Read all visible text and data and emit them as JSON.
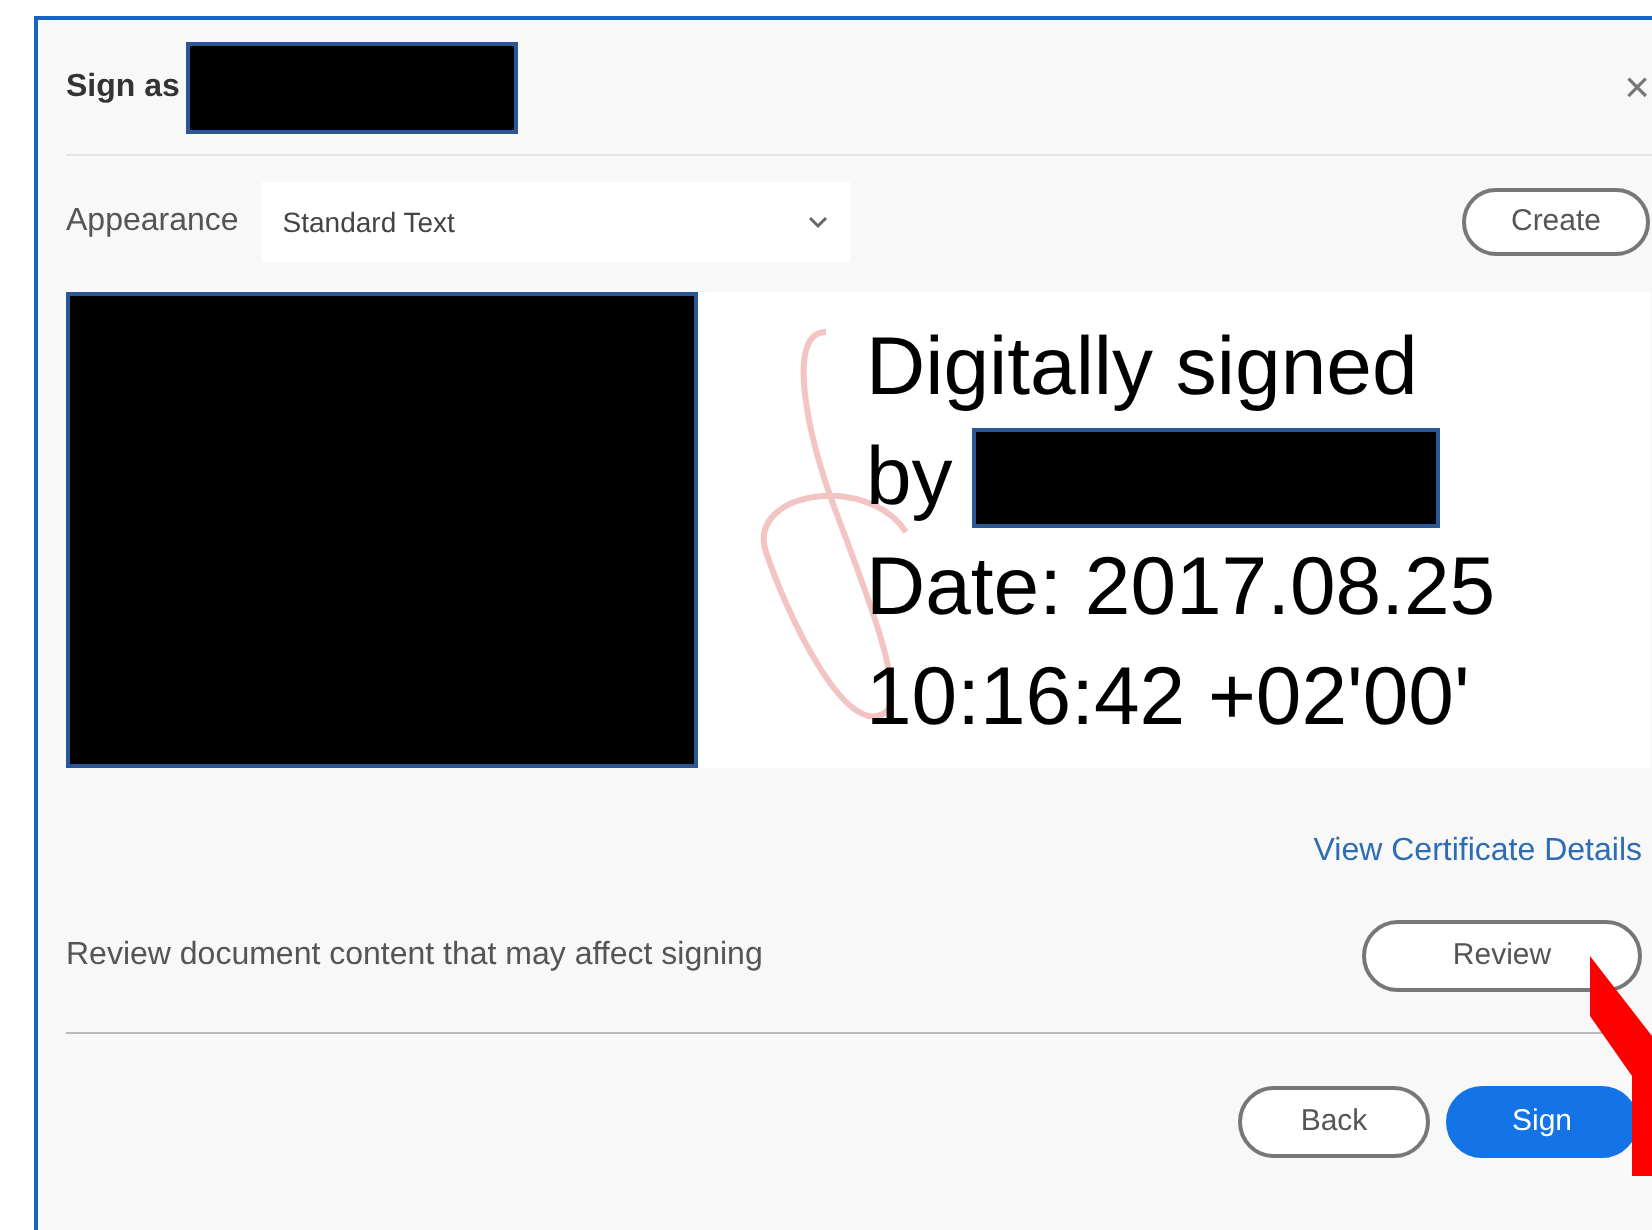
{
  "dialog": {
    "title": "Sign as",
    "close": "×"
  },
  "appearance": {
    "label": "Appearance",
    "value": "Standard Text",
    "create_button": "Create"
  },
  "preview": {
    "lines": [
      "Digitally signed",
      "by",
      "Date: 2017.08.25",
      "10:16:42 +02'00'"
    ]
  },
  "certificate_link": "View Certificate Details",
  "review": {
    "text": "Review document content that may affect signing",
    "button": "Review"
  },
  "buttons": [
    {
      "label": "Back",
      "kind": "secondary"
    },
    {
      "label": "Sign",
      "kind": "primary"
    }
  ]
}
